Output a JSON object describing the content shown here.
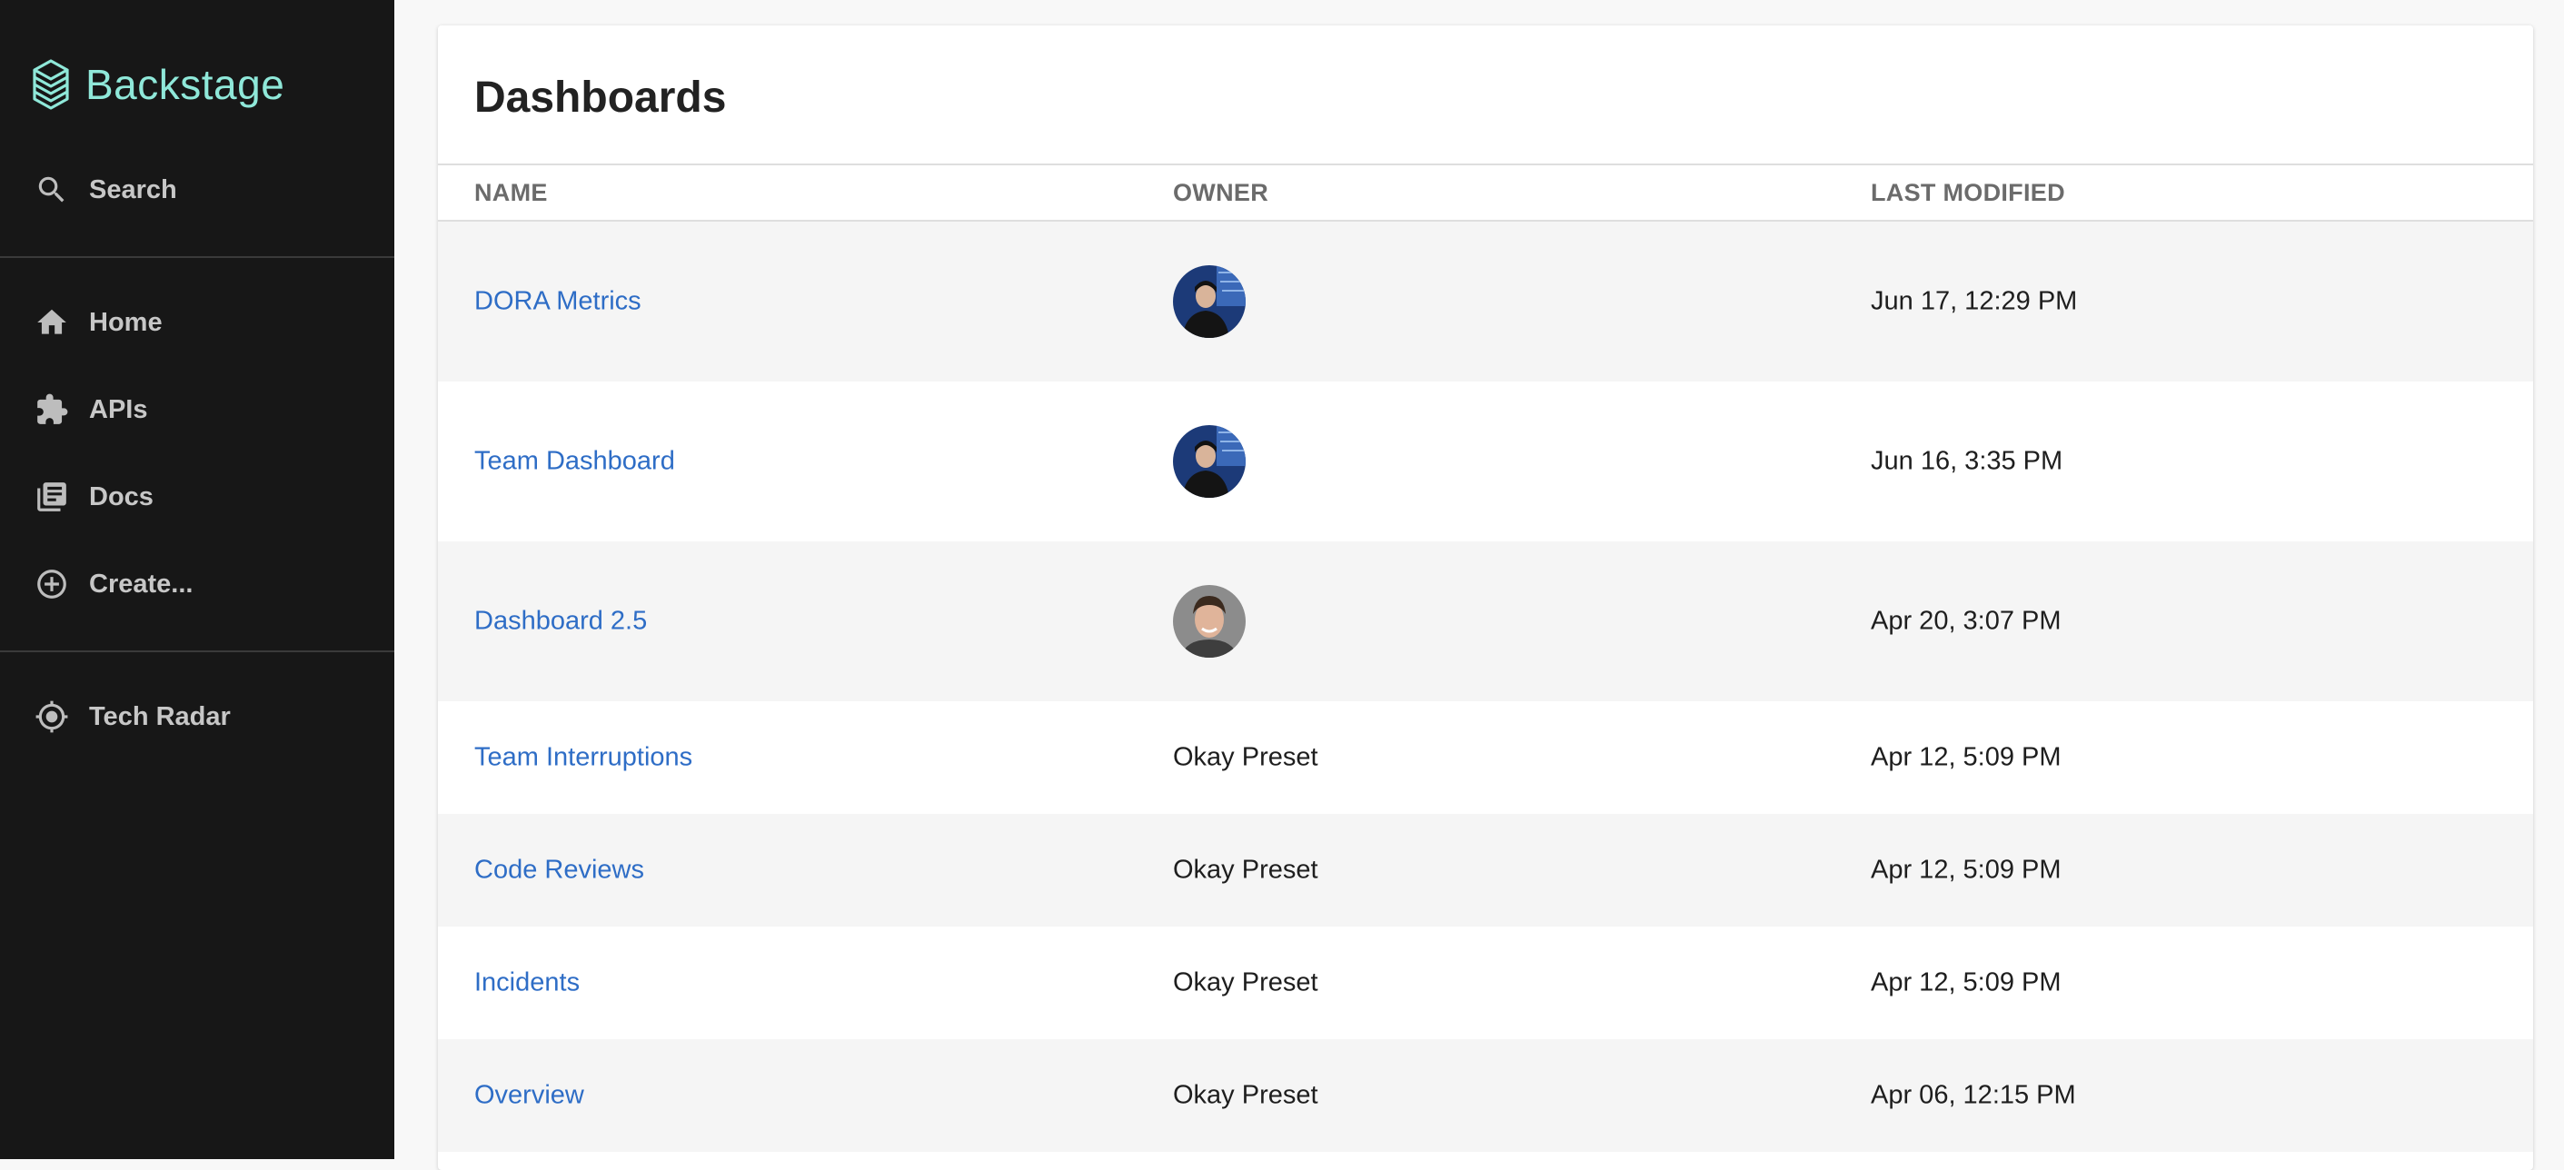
{
  "sidebar": {
    "brand": "Backstage",
    "search_label": "Search",
    "items": [
      {
        "label": "Home",
        "icon": "home-icon"
      },
      {
        "label": "APIs",
        "icon": "puzzle-icon"
      },
      {
        "label": "Docs",
        "icon": "library-books-icon"
      },
      {
        "label": "Create...",
        "icon": "add-circle-icon"
      }
    ],
    "tech_radar_label": "Tech Radar"
  },
  "page": {
    "title": "Dashboards"
  },
  "table": {
    "headers": {
      "name": "NAME",
      "owner": "OWNER",
      "last_modified": "LAST MODIFIED"
    },
    "rows": [
      {
        "name": "DORA Metrics",
        "owner": "",
        "owner_avatar": "avatar-dark",
        "last_modified": "Jun 17, 12:29 PM"
      },
      {
        "name": "Team Dashboard",
        "owner": "",
        "owner_avatar": "avatar-dark",
        "last_modified": "Jun 16, 3:35 PM"
      },
      {
        "name": "Dashboard 2.5",
        "owner": "",
        "owner_avatar": "avatar-light",
        "last_modified": "Apr 20, 3:07 PM"
      },
      {
        "name": "Team Interruptions",
        "owner": "Okay Preset",
        "owner_avatar": "",
        "last_modified": "Apr 12, 5:09 PM"
      },
      {
        "name": "Code Reviews",
        "owner": "Okay Preset",
        "owner_avatar": "",
        "last_modified": "Apr 12, 5:09 PM"
      },
      {
        "name": "Incidents",
        "owner": "Okay Preset",
        "owner_avatar": "",
        "last_modified": "Apr 12, 5:09 PM"
      },
      {
        "name": "Overview",
        "owner": "Okay Preset",
        "owner_avatar": "",
        "last_modified": "Apr 06, 12:15 PM"
      }
    ]
  },
  "colors": {
    "sidebar_bg": "#171717",
    "brand": "#8fe8d9",
    "link": "#2e6dc6",
    "row_alt": "#f5f5f5"
  }
}
